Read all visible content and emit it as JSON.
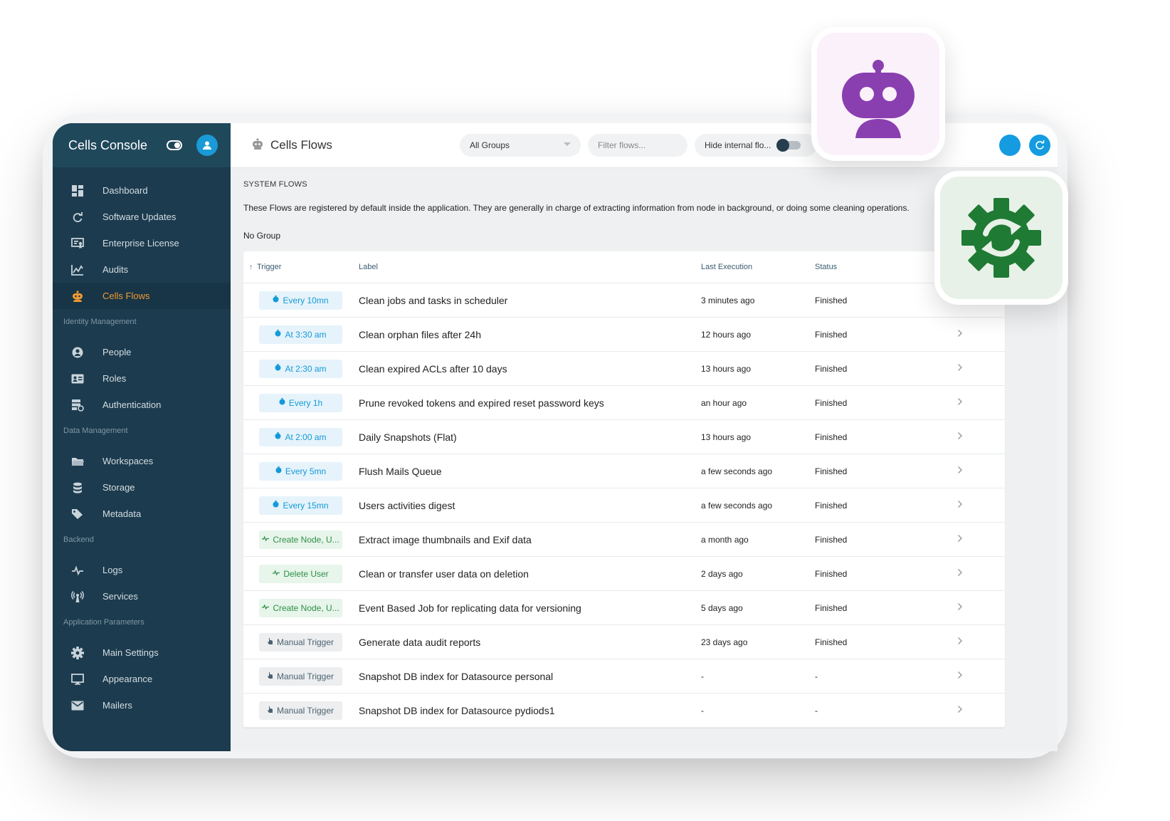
{
  "sidebar": {
    "title": "Cells Console",
    "items_main": [
      {
        "label": "Dashboard",
        "icon": "dashboard-icon"
      },
      {
        "label": "Software Updates",
        "icon": "update-icon"
      },
      {
        "label": "Enterprise License",
        "icon": "license-icon"
      },
      {
        "label": "Audits",
        "icon": "audits-icon"
      },
      {
        "label": "Cells Flows",
        "icon": "robot-icon"
      }
    ],
    "section_identity": "Identity Management",
    "items_identity": [
      {
        "label": "People",
        "icon": "person-icon"
      },
      {
        "label": "Roles",
        "icon": "roles-icon"
      },
      {
        "label": "Authentication",
        "icon": "authentication-icon"
      }
    ],
    "section_data": "Data Management",
    "items_data": [
      {
        "label": "Workspaces",
        "icon": "folder-icon"
      },
      {
        "label": "Storage",
        "icon": "database-icon"
      },
      {
        "label": "Metadata",
        "icon": "tag-icon"
      }
    ],
    "section_backend": "Backend",
    "items_backend": [
      {
        "label": "Logs",
        "icon": "pulse-icon"
      },
      {
        "label": "Services",
        "icon": "services-icon"
      }
    ],
    "section_params": "Application Parameters",
    "items_params": [
      {
        "label": "Main Settings",
        "icon": "gear-icon"
      },
      {
        "label": "Appearance",
        "icon": "monitor-icon"
      },
      {
        "label": "Mailers",
        "icon": "mail-icon"
      }
    ]
  },
  "topbar": {
    "title": "Cells Flows",
    "group_select": "All Groups",
    "filter_placeholder": "Filter flows...",
    "hide_internal": "Hide internal flo..."
  },
  "content": {
    "section_title": "SYSTEM FLOWS",
    "description": "These Flows are registered by default inside the application. They are generally in charge of extracting information from node in background, or doing some cleaning operations.",
    "group_name": "No Group"
  },
  "table": {
    "headers": {
      "trigger": "Trigger",
      "label": "Label",
      "last": "Last Execution",
      "status": "Status"
    },
    "rows": [
      {
        "trigger": "Every 10mn",
        "kind": "time",
        "label": "Clean jobs and tasks in scheduler",
        "last": "3 minutes ago",
        "status": "Finished"
      },
      {
        "trigger": "At 3:30 am",
        "kind": "time",
        "label": "Clean orphan files after 24h",
        "last": "12 hours ago",
        "status": "Finished"
      },
      {
        "trigger": "At 2:30 am",
        "kind": "time",
        "label": "Clean expired ACLs after 10 days",
        "last": "13 hours ago",
        "status": "Finished"
      },
      {
        "trigger": "Every 1h",
        "kind": "time",
        "label": "Prune revoked tokens and expired reset password keys",
        "last": "an hour ago",
        "status": "Finished"
      },
      {
        "trigger": "At 2:00 am",
        "kind": "time",
        "label": "Daily Snapshots (Flat)",
        "last": "13 hours ago",
        "status": "Finished"
      },
      {
        "trigger": "Every 5mn",
        "kind": "time",
        "label": "Flush Mails Queue",
        "last": "a few seconds ago",
        "status": "Finished"
      },
      {
        "trigger": "Every 15mn",
        "kind": "time",
        "label": "Users activities digest",
        "last": "a few seconds ago",
        "status": "Finished"
      },
      {
        "trigger": "Create Node, U...",
        "kind": "event",
        "label": "Extract image thumbnails and Exif data",
        "last": "a month ago",
        "status": "Finished"
      },
      {
        "trigger": "Delete User",
        "kind": "event",
        "label": "Clean or transfer user data on deletion",
        "last": "2 days ago",
        "status": "Finished"
      },
      {
        "trigger": "Create Node, U...",
        "kind": "event",
        "label": "Event Based Job for replicating data for versioning",
        "last": "5 days ago",
        "status": "Finished"
      },
      {
        "trigger": "Manual Trigger",
        "kind": "manual",
        "label": "Generate data audit reports",
        "last": "23 days ago",
        "status": "Finished"
      },
      {
        "trigger": "Manual Trigger",
        "kind": "manual",
        "label": "Snapshot DB index for Datasource personal",
        "last": "-",
        "status": "-"
      },
      {
        "trigger": "Manual Trigger",
        "kind": "manual",
        "label": "Snapshot DB index for Datasource pydiods1",
        "last": "-",
        "status": "-"
      }
    ]
  },
  "colors": {
    "sidebar": "#1c3b4e",
    "accent_orange": "#f29a32",
    "accent_blue": "#159be0",
    "robot_purple": "#8a3fb0",
    "gear_green": "#1f7a34"
  }
}
